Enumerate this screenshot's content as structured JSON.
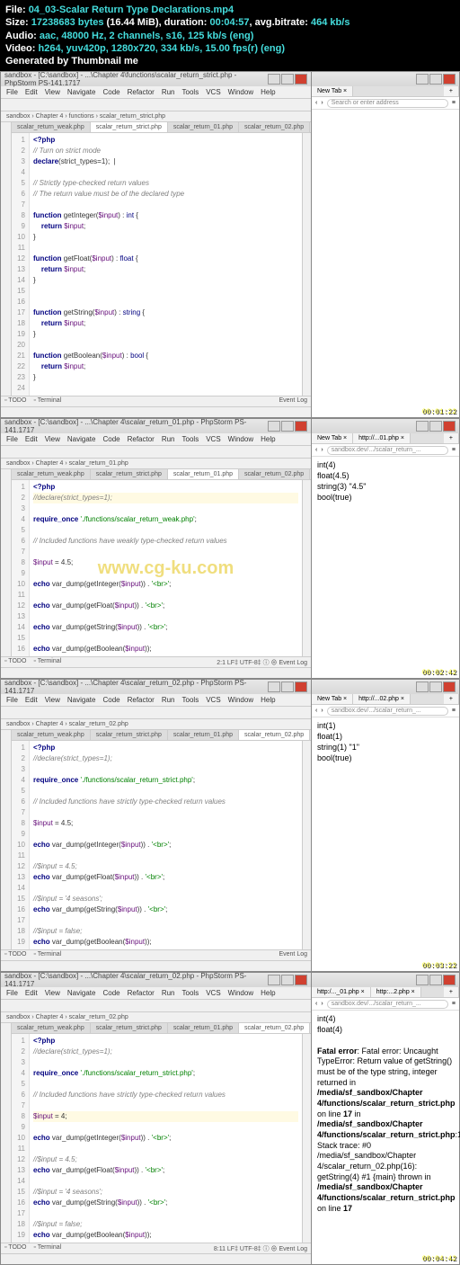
{
  "header": {
    "file_label": "File:",
    "file_value": "04_03-Scalar Return Type Declarations.mp4",
    "size_label": "Size:",
    "size_bytes": "17238683 bytes",
    "size_mib": "(16.44 MiB)",
    "duration_label": "duration:",
    "duration_value": "00:04:57",
    "bitrate_label": "avg.bitrate:",
    "bitrate_value": "464 kb/s",
    "audio_label": "Audio:",
    "audio_value": "aac, 48000 Hz, 2 channels, s16, 125 kb/s (eng)",
    "video_label": "Video:",
    "video_value": "h264, yuv420p, 1280x720, 334 kb/s, 15.00 fps(r) (eng)",
    "gen_label": "Generated by Thumbnail me"
  },
  "menus": [
    "File",
    "Edit",
    "View",
    "Navigate",
    "Code",
    "Refactor",
    "Run",
    "Tools",
    "VCS",
    "Window",
    "Help"
  ],
  "watermark": "www.cg-ku.com",
  "panes": [
    {
      "title": "sandbox - [C:\\sandbox] - ...\\Chapter 4\\functions\\scalar_return_strict.php - PhpStorm PS-141.1717",
      "crumb": "sandbox › Chapter 4 › functions › scalar_return_strict.php",
      "tabs": [
        "scalar_return_weak.php",
        "scalar_return_strict.php",
        "scalar_return_01.php",
        "scalar_return_02.php"
      ],
      "active_tab": 1,
      "browser_tab": "New Tab",
      "browser_addr": "Search or enter address",
      "browser_body_type": "blank",
      "timestamp": "00:01:22",
      "code_lines": [
        {
          "n": 1,
          "t": "<?php",
          "cls": "kw"
        },
        {
          "n": 2,
          "t": "// Turn on strict mode",
          "cls": "com"
        },
        {
          "n": 3,
          "t": "declare(strict_types=1);  |",
          "cls": ""
        },
        {
          "n": 4,
          "t": "",
          "cls": ""
        },
        {
          "n": 5,
          "t": "// Strictly type-checked return values",
          "cls": "com"
        },
        {
          "n": 6,
          "t": "// The return value must be of the declared type",
          "cls": "com"
        },
        {
          "n": 7,
          "t": "",
          "cls": ""
        },
        {
          "n": 8,
          "t": "function getInteger($input) : int {",
          "cls": ""
        },
        {
          "n": 9,
          "t": "    return $input;",
          "cls": ""
        },
        {
          "n": 10,
          "t": "}",
          "cls": ""
        },
        {
          "n": 11,
          "t": "",
          "cls": ""
        },
        {
          "n": 12,
          "t": "function getFloat($input) : float {",
          "cls": ""
        },
        {
          "n": 13,
          "t": "    return $input;",
          "cls": ""
        },
        {
          "n": 14,
          "t": "}",
          "cls": ""
        },
        {
          "n": 15,
          "t": "",
          "cls": ""
        },
        {
          "n": 16,
          "t": "",
          "cls": ""
        },
        {
          "n": 17,
          "t": "function getString($input) : string {",
          "cls": ""
        },
        {
          "n": 18,
          "t": "    return $input;",
          "cls": ""
        },
        {
          "n": 19,
          "t": "}",
          "cls": ""
        },
        {
          "n": 20,
          "t": "",
          "cls": ""
        },
        {
          "n": 21,
          "t": "function getBoolean($input) : bool {",
          "cls": ""
        },
        {
          "n": 22,
          "t": "    return $input;",
          "cls": ""
        },
        {
          "n": 23,
          "t": "}",
          "cls": ""
        },
        {
          "n": 24,
          "t": "",
          "cls": ""
        }
      ],
      "status_right": "Event Log",
      "bot_tabs": [
        "TODO",
        "Terminal"
      ]
    },
    {
      "title": "sandbox - [C:\\sandbox] - ...\\Chapter 4\\scalar_return_01.php - PhpStorm PS-141.1717",
      "crumb": "sandbox › Chapter 4 › scalar_return_01.php",
      "tabs": [
        "scalar_return_weak.php",
        "scalar_return_strict.php",
        "scalar_return_01.php",
        "scalar_return_02.php"
      ],
      "active_tab": 2,
      "browser_tab": "New Tab",
      "browser_tab2": "http://...01.php",
      "browser_addr": "sandbox.dev/.../scalar_return_...",
      "browser_body_type": "output1",
      "browser_output": [
        "int(4)",
        "float(4.5)",
        "string(3) \"4.5\"",
        "bool(true)"
      ],
      "timestamp": "00:02:42",
      "code_lines": [
        {
          "n": 1,
          "t": "<?php",
          "cls": "kw"
        },
        {
          "n": 2,
          "t": "//declare(strict_types=1);",
          "cls": "com hl"
        },
        {
          "n": 3,
          "t": "",
          "cls": ""
        },
        {
          "n": 4,
          "t": "require_once './functions/scalar_return_weak.php';",
          "cls": ""
        },
        {
          "n": 5,
          "t": "",
          "cls": ""
        },
        {
          "n": 6,
          "t": "// Included functions have weakly type-checked return values",
          "cls": "com"
        },
        {
          "n": 7,
          "t": "",
          "cls": ""
        },
        {
          "n": 8,
          "t": "$input = 4.5;",
          "cls": ""
        },
        {
          "n": 9,
          "t": "",
          "cls": ""
        },
        {
          "n": 10,
          "t": "echo var_dump(getInteger($input)) . '<br>';",
          "cls": ""
        },
        {
          "n": 11,
          "t": "",
          "cls": ""
        },
        {
          "n": 12,
          "t": "echo var_dump(getFloat($input)) . '<br>';",
          "cls": ""
        },
        {
          "n": 13,
          "t": "",
          "cls": ""
        },
        {
          "n": 14,
          "t": "echo var_dump(getString($input)) . '<br>';",
          "cls": ""
        },
        {
          "n": 15,
          "t": "",
          "cls": ""
        },
        {
          "n": 16,
          "t": "echo var_dump(getBoolean($input));",
          "cls": ""
        }
      ],
      "status_right": "2:1  LF‡  UTF-8‡  ⓘ ⊕  Event Log",
      "bot_tabs": [
        "TODO",
        "Terminal"
      ]
    },
    {
      "title": "sandbox - [C:\\sandbox] - ...\\Chapter 4\\scalar_return_02.php - PhpStorm PS-141.1717",
      "crumb": "sandbox › Chapter 4 › scalar_return_02.php",
      "tabs": [
        "scalar_return_weak.php",
        "scalar_return_strict.php",
        "scalar_return_01.php",
        "scalar_return_02.php"
      ],
      "active_tab": 3,
      "browser_tab": "New Tab",
      "browser_tab2": "http://...02.php",
      "browser_addr": "sandbox.dev/.../scalar_return_...",
      "browser_body_type": "output2",
      "browser_output": [
        "int(1)",
        "float(1)",
        "string(1) \"1\"",
        "bool(true)"
      ],
      "timestamp": "00:03:22",
      "code_lines": [
        {
          "n": 1,
          "t": "<?php",
          "cls": "kw"
        },
        {
          "n": 2,
          "t": "//declare(strict_types=1);",
          "cls": "com"
        },
        {
          "n": 3,
          "t": "",
          "cls": ""
        },
        {
          "n": 4,
          "t": "require_once './functions/scalar_return_strict.php';",
          "cls": ""
        },
        {
          "n": 5,
          "t": "",
          "cls": ""
        },
        {
          "n": 6,
          "t": "// Included functions have strictly type-checked return values",
          "cls": "com"
        },
        {
          "n": 7,
          "t": "",
          "cls": ""
        },
        {
          "n": 8,
          "t": "$input = 4.5;",
          "cls": ""
        },
        {
          "n": 9,
          "t": "",
          "cls": ""
        },
        {
          "n": 10,
          "t": "echo var_dump(getInteger($input)) . '<br>';",
          "cls": ""
        },
        {
          "n": 11,
          "t": "",
          "cls": ""
        },
        {
          "n": 12,
          "t": "//$input = 4.5;",
          "cls": "com"
        },
        {
          "n": 13,
          "t": "echo var_dump(getFloat($input)) . '<br>';",
          "cls": ""
        },
        {
          "n": 14,
          "t": "",
          "cls": ""
        },
        {
          "n": 15,
          "t": "//$input = '4 seasons';",
          "cls": "com"
        },
        {
          "n": 16,
          "t": "echo var_dump(getString($input)) . '<br>';",
          "cls": ""
        },
        {
          "n": 17,
          "t": "",
          "cls": ""
        },
        {
          "n": 18,
          "t": "//$input = false;",
          "cls": "com"
        },
        {
          "n": 19,
          "t": "echo var_dump(getBoolean($input));",
          "cls": ""
        }
      ],
      "status_right": "Event Log",
      "bot_tabs": [
        "TODO",
        "Terminal"
      ]
    },
    {
      "title": "sandbox - [C:\\sandbox] - ...\\Chapter 4\\scalar_return_02.php - PhpStorm PS-141.1717",
      "crumb": "sandbox › Chapter 4 › scalar_return_02.php",
      "tabs": [
        "scalar_return_weak.php",
        "scalar_return_strict.php",
        "scalar_return_01.php",
        "scalar_return_02.php"
      ],
      "active_tab": 3,
      "browser_tab": "http:/..._01.php",
      "browser_tab2": "http:...2.php",
      "browser_addr": "sandbox.dev/.../scalar_return_...",
      "browser_body_type": "error",
      "browser_output": [
        "int(4)",
        "float(4)"
      ],
      "browser_error": "Fatal error: Uncaught TypeError: Return value of getString() must be of the type string, integer returned in /media/sf_sandbox/Chapter 4/functions/scalar_return_strict.php on line 17 in /media/sf_sandbox/Chapter 4/functions/scalar_return_strict.php:17 Stack trace: #0 /media/sf_sandbox/Chapter 4/scalar_return_02.php(16): getString(4) #1 {main} thrown in /media/sf_sandbox/Chapter 4/functions/scalar_return_strict.php on line 17",
      "timestamp": "00:04:42",
      "code_lines": [
        {
          "n": 1,
          "t": "<?php",
          "cls": "kw"
        },
        {
          "n": 2,
          "t": "//declare(strict_types=1);",
          "cls": "com"
        },
        {
          "n": 3,
          "t": "",
          "cls": ""
        },
        {
          "n": 4,
          "t": "require_once './functions/scalar_return_strict.php';",
          "cls": ""
        },
        {
          "n": 5,
          "t": "",
          "cls": ""
        },
        {
          "n": 6,
          "t": "// Included functions have strictly type-checked return values",
          "cls": "com"
        },
        {
          "n": 7,
          "t": "",
          "cls": ""
        },
        {
          "n": 8,
          "t": "$input = 4;",
          "cls": "hl"
        },
        {
          "n": 9,
          "t": "",
          "cls": ""
        },
        {
          "n": 10,
          "t": "echo var_dump(getInteger($input)) . '<br>';",
          "cls": ""
        },
        {
          "n": 11,
          "t": "",
          "cls": ""
        },
        {
          "n": 12,
          "t": "//$input = 4.5;",
          "cls": "com"
        },
        {
          "n": 13,
          "t": "echo var_dump(getFloat($input)) . '<br>';",
          "cls": ""
        },
        {
          "n": 14,
          "t": "",
          "cls": ""
        },
        {
          "n": 15,
          "t": "//$input = '4 seasons';",
          "cls": "com"
        },
        {
          "n": 16,
          "t": "echo var_dump(getString($input)) . '<br>';",
          "cls": ""
        },
        {
          "n": 17,
          "t": "",
          "cls": ""
        },
        {
          "n": 18,
          "t": "//$input = false;",
          "cls": "com"
        },
        {
          "n": 19,
          "t": "echo var_dump(getBoolean($input));",
          "cls": ""
        }
      ],
      "status_right": "8:11  LF‡  UTF-8‡  ⓘ ⊕  Event Log",
      "bot_tabs": [
        "TODO",
        "Terminal"
      ]
    }
  ]
}
